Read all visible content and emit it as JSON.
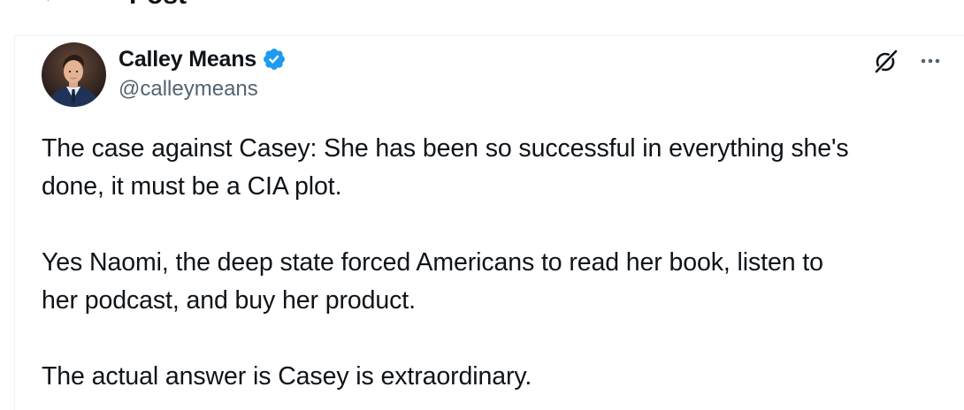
{
  "header": {
    "back_icon": "arrow-left-icon",
    "title": "Post"
  },
  "post": {
    "author": {
      "display_name": "Calley Means",
      "handle": "@calleymeans",
      "verified": true,
      "verified_badge_color": "#1d9bf0"
    },
    "actions": {
      "grok_icon": "grok-icon",
      "more_icon": "more-horizontal-icon"
    },
    "text": {
      "p1": "The case against Casey: She has been so successful in everything she's\ndone, it must be a CIA plot.",
      "p2": "Yes Naomi, the deep state forced Americans to read her book, listen to\nher podcast, and buy her product.",
      "p3": "The actual answer is Casey is extraordinary."
    }
  },
  "colors": {
    "text_primary": "#0f1419",
    "text_secondary": "#536471",
    "accent": "#1d9bf0",
    "border": "#eff3f4"
  }
}
